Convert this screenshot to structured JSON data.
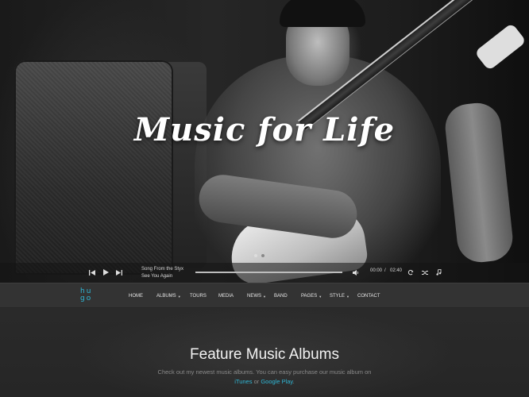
{
  "hero": {
    "title": "Music for Life"
  },
  "player": {
    "prev_icon": "skip-back-icon",
    "play_icon": "play-icon",
    "next_icon": "skip-forward-icon",
    "track_title": "Song From the Styx",
    "track_artist": "See You Again",
    "current_time": "00:00",
    "separator": "/",
    "duration": "02:40",
    "progress": 0,
    "volume_icon": "volume-icon",
    "repeat_icon": "repeat-icon",
    "shuffle_icon": "shuffle-icon",
    "playlist_icon": "music-note-icon"
  },
  "nav": {
    "logo_line1": "hu",
    "logo_line2": "go",
    "items": [
      {
        "label": "HOME",
        "dropdown": false
      },
      {
        "label": "ALBUMS",
        "dropdown": true
      },
      {
        "label": "TOURS",
        "dropdown": false
      },
      {
        "label": "MEDIA",
        "dropdown": false
      },
      {
        "label": "NEWS",
        "dropdown": true
      },
      {
        "label": "BAND",
        "dropdown": false
      },
      {
        "label": "PAGES",
        "dropdown": true
      },
      {
        "label": "STYLE",
        "dropdown": true
      },
      {
        "label": "CONTACT",
        "dropdown": false
      }
    ]
  },
  "feature": {
    "title": "Feature Music Albums",
    "desc_line1": "Check out my newest music albums. You can easy purchase our music album on",
    "itunes": "iTunes",
    "or": " or ",
    "google_play": "Google Play",
    "period": "."
  },
  "colors": {
    "accent": "#2fb7d6",
    "nav_bg": "#333333",
    "section_bg": "#2a2a2a"
  }
}
